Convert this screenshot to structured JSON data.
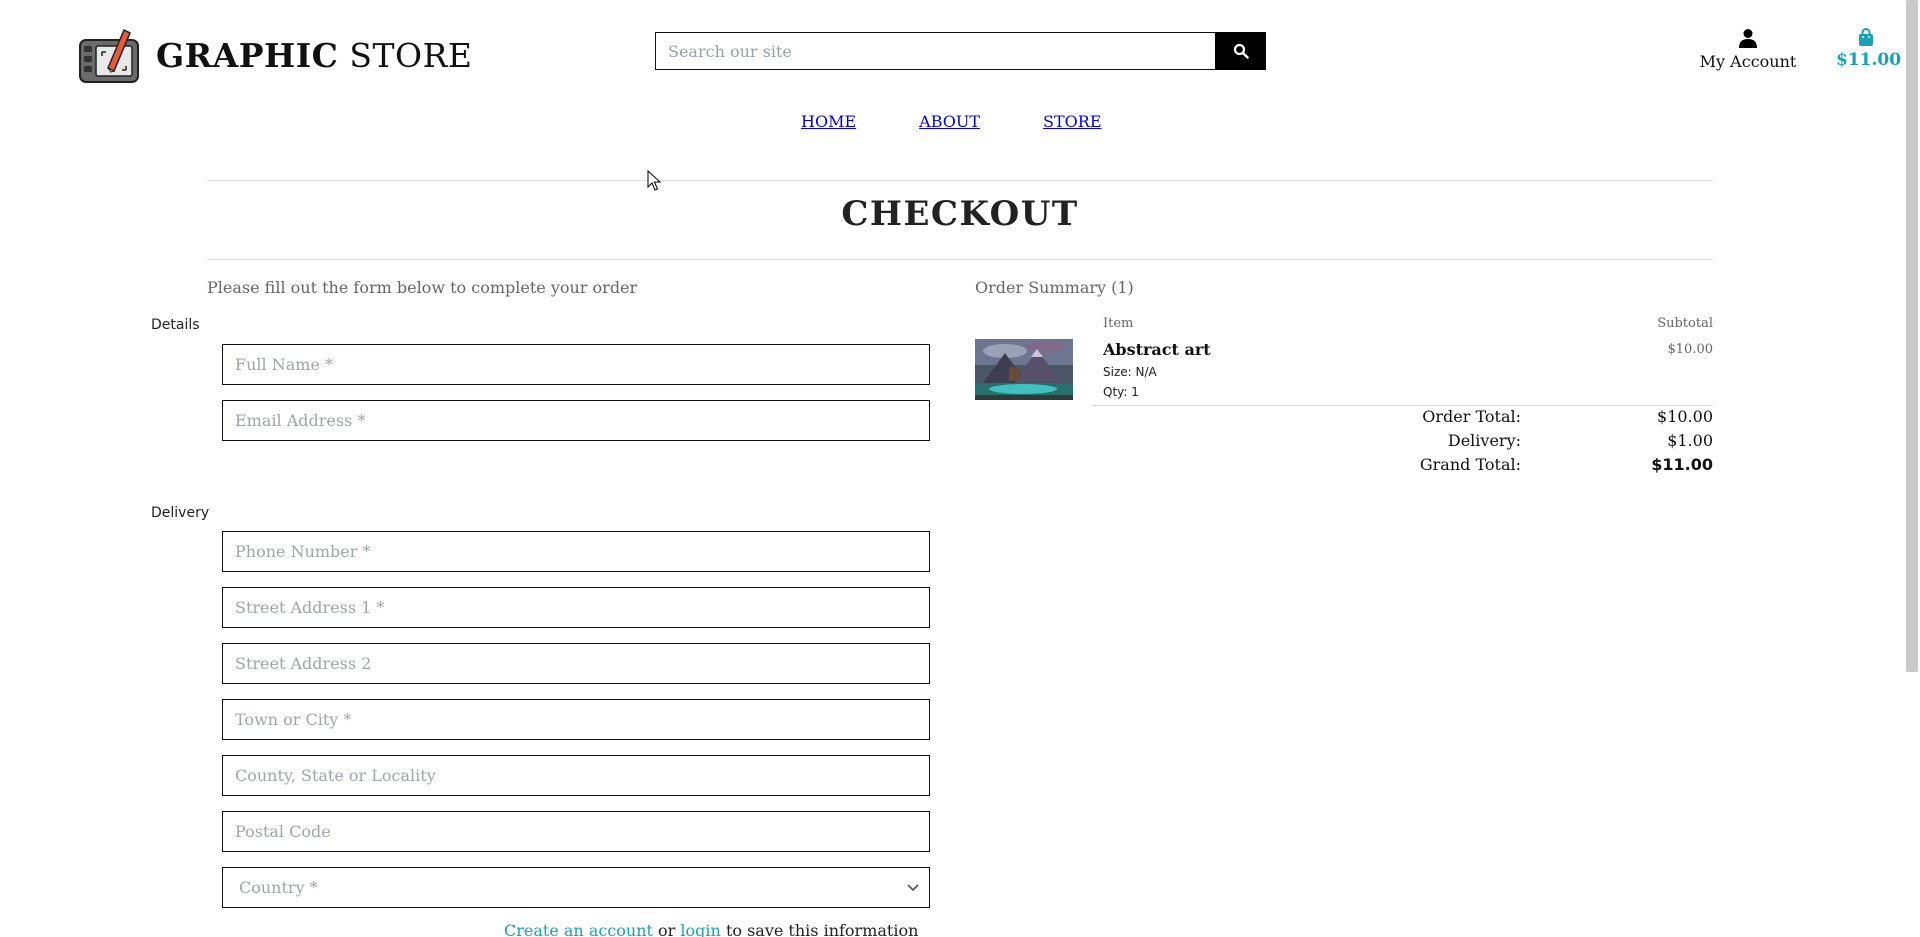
{
  "header": {
    "brand_bold": "GRAPHIC",
    "brand_light": "STORE",
    "search_placeholder": "Search our site",
    "account_label": "My Account",
    "cart_total": "$11.00"
  },
  "nav": {
    "items": [
      "HOME",
      "ABOUT",
      "STORE"
    ]
  },
  "page": {
    "title": "CHECKOUT",
    "intro": "Please fill out the form below to complete your order"
  },
  "form": {
    "details_label": "Details",
    "delivery_label": "Delivery",
    "full_name_placeholder": "Full Name *",
    "email_placeholder": "Email Address *",
    "phone_placeholder": "Phone Number *",
    "street1_placeholder": "Street Address 1 *",
    "street2_placeholder": "Street Address 2",
    "town_placeholder": "Town or City *",
    "county_placeholder": "County, State or Locality",
    "postal_placeholder": "Postal Code",
    "country_placeholder": "Country *",
    "save_info": {
      "create_account": "Create an account",
      "or": "or",
      "login": "login",
      "suffix": "to save this information"
    }
  },
  "summary": {
    "title": "Order Summary (1)",
    "col_item": "Item",
    "col_subtotal": "Subtotal",
    "item": {
      "name": "Abstract art",
      "size": "Size: N/A",
      "qty": "Qty: 1",
      "subtotal": "$10.00"
    },
    "order_total_label": "Order Total:",
    "order_total": "$10.00",
    "delivery_label": "Delivery:",
    "delivery": "$1.00",
    "grand_total_label": "Grand Total:",
    "grand_total": "$11.00"
  },
  "colors": {
    "accent": "#17a2b8",
    "text": "#111111",
    "muted": "#666666"
  }
}
